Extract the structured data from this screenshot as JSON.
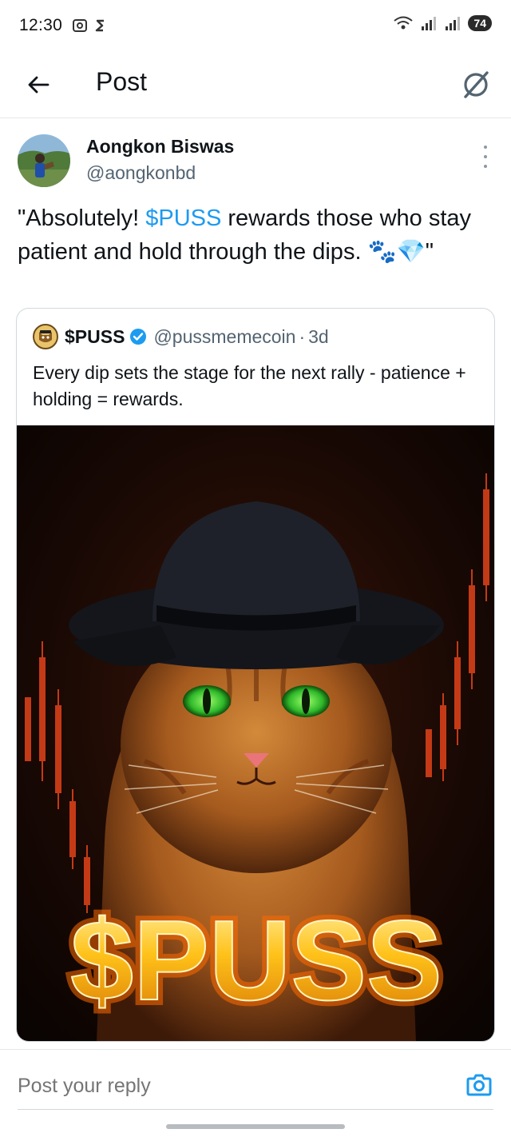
{
  "status_bar": {
    "time": "12:30",
    "battery": "74"
  },
  "header": {
    "title": "Post",
    "back_icon": "arrow-left-icon",
    "grok_icon": "grok-icon"
  },
  "post": {
    "author_name": "Aongkon Biswas",
    "author_handle": "@aongkonbd",
    "text_before": "\"Absolutely! ",
    "cashtag": "$PUSS",
    "text_after": " rewards those who stay patient and hold through the dips. 🐾💎\""
  },
  "quote": {
    "name": "$PUSS",
    "handle": "@pussmemecoin",
    "separator": "·",
    "time": "3d",
    "text": "Every dip sets the stage for the next rally - patience + holding = rewards.",
    "image_caption": "$PUSS"
  },
  "reply": {
    "placeholder": "Post your reply"
  },
  "colors": {
    "accent": "#1d9bf0",
    "text": "#0f1419",
    "muted": "#536471"
  }
}
